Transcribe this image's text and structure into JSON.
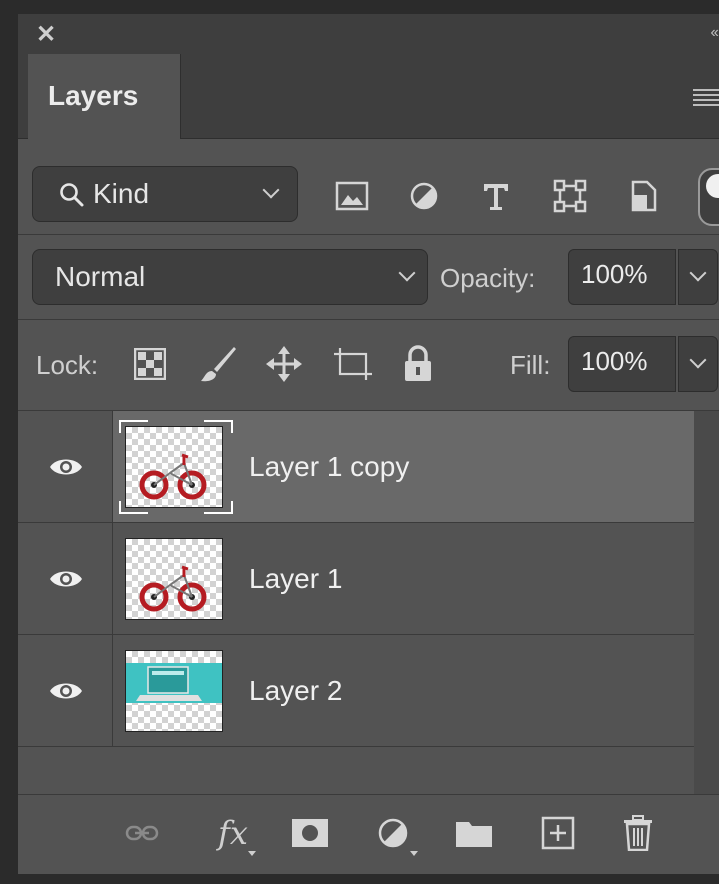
{
  "window": {
    "close_icon": "close-icon",
    "collapse_label": "‹‹"
  },
  "panel": {
    "tab_label": "Layers",
    "menu_icon": "panel-menu-icon"
  },
  "filter": {
    "kind_label": "Kind",
    "icons": [
      "image-filter-icon",
      "adjustment-filter-icon",
      "type-filter-icon",
      "shape-filter-icon",
      "smart-object-filter-icon"
    ]
  },
  "blend": {
    "mode": "Normal",
    "opacity_label": "Opacity:",
    "opacity_value": "100%"
  },
  "lock": {
    "label": "Lock:",
    "icons": [
      "lock-transparent-pixels-icon",
      "lock-image-pixels-icon",
      "lock-position-icon",
      "lock-artboard-icon",
      "lock-all-icon"
    ],
    "fill_label": "Fill:",
    "fill_value": "100%"
  },
  "layers": [
    {
      "name": "Layer 1 copy",
      "visible": true,
      "selected": true,
      "thumbnail": "bicycle"
    },
    {
      "name": "Layer 1",
      "visible": true,
      "selected": false,
      "thumbnail": "bicycle"
    },
    {
      "name": "Layer 2",
      "visible": true,
      "selected": false,
      "thumbnail": "laptop"
    }
  ],
  "footer_icons": [
    "link-layers-icon",
    "fx-icon",
    "mask-icon",
    "adjustment-layer-icon",
    "group-folder-icon",
    "new-layer-icon",
    "trash-icon"
  ],
  "footer_fx_label": "fx",
  "colors": {
    "panel": "#535353",
    "header": "#3e3e3e",
    "selected_layer": "#696969",
    "field": "#3f3f3f",
    "bike_red": "#b51c22",
    "laptop_teal": "#3fc2c2"
  }
}
